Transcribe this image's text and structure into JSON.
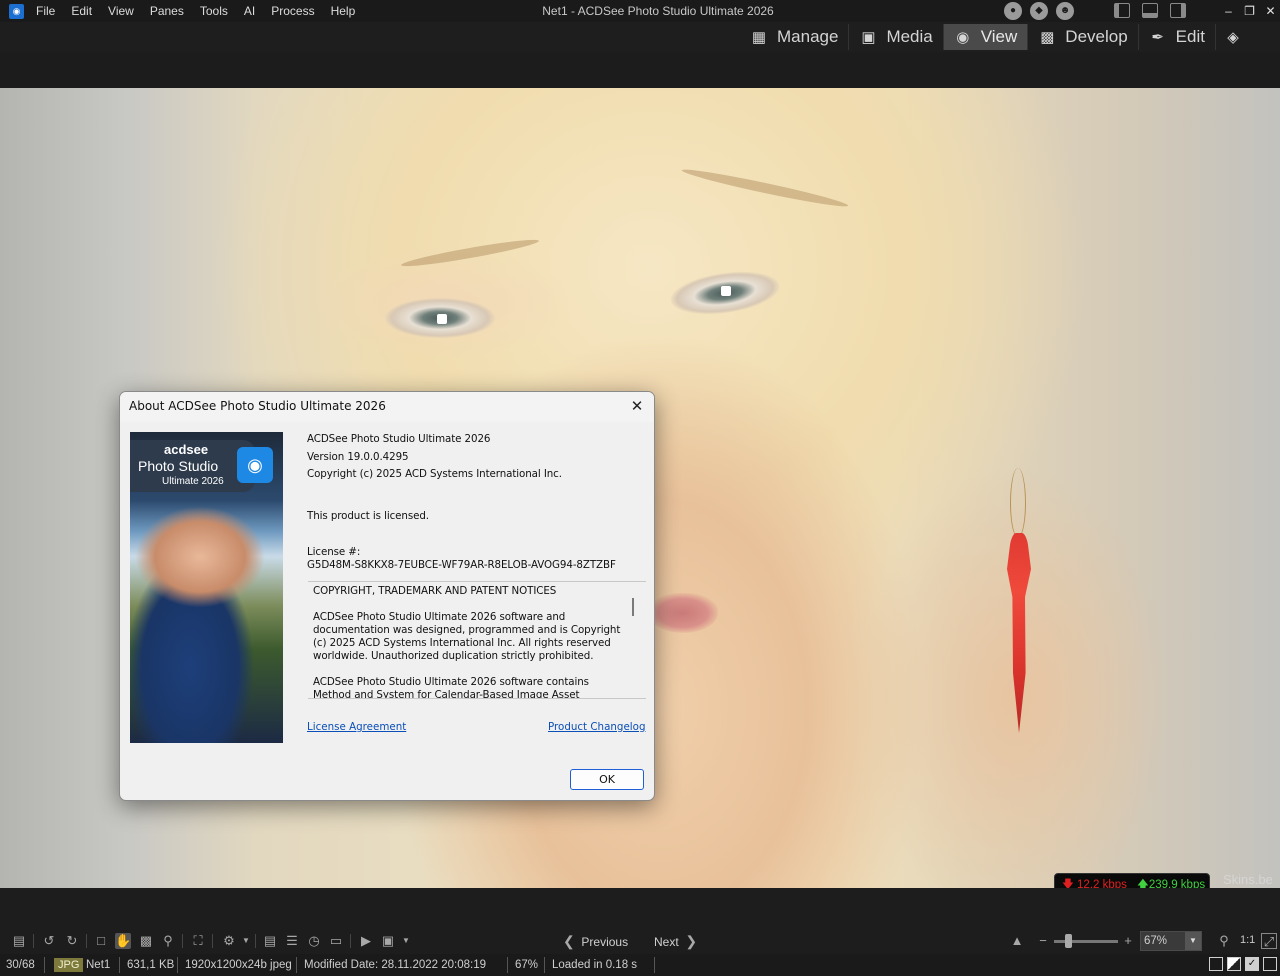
{
  "window": {
    "title": "Net1 - ACDSee Photo Studio Ultimate 2026",
    "menu": [
      "File",
      "Edit",
      "View",
      "Panes",
      "Tools",
      "AI",
      "Process",
      "Help"
    ]
  },
  "modes": [
    {
      "label": "Manage",
      "icon": "grid-icon",
      "active": false
    },
    {
      "label": "Media",
      "icon": "photos-icon",
      "active": false
    },
    {
      "label": "View",
      "icon": "eye-icon",
      "active": true
    },
    {
      "label": "Develop",
      "icon": "develop-icon",
      "active": false
    },
    {
      "label": "Edit",
      "icon": "brush-icon",
      "active": false
    }
  ],
  "dialog": {
    "title": "About ACDSee Photo Studio Ultimate 2026",
    "product_name": "ACDSee Photo Studio Ultimate 2026",
    "version": "Version 19.0.0.4295",
    "copyright": "Copyright (c) 2025 ACD Systems International Inc.",
    "licensed": "This product is licensed.",
    "license_label": "License #:",
    "license_key": "G5D48M-S8KKX8-7EUBCE-WF79AR-R8ELOB-AVOG94-8ZTZBF",
    "notice_text": "COPYRIGHT, TRADEMARK AND PATENT NOTICES\n\nACDSee Photo Studio Ultimate 2026 software and documentation was designed, programmed and is Copyright (c) 2025 ACD Systems International Inc. All rights reserved worldwide. Unauthorized duplication strictly prohibited.\n\nACDSee Photo Studio Ultimate 2026 software contains Method and System for Calendar-Based Image Asset Organization.",
    "link_license": "License Agreement",
    "link_changelog": "Product Changelog",
    "ok_label": "OK",
    "art": {
      "brand": "acdsee",
      "product": "Photo Studio",
      "edition": "Ultimate 2026"
    }
  },
  "network": {
    "down": "12,2 kbps",
    "up": "239,9 kbps",
    "watermark": "Skins.be"
  },
  "nav": {
    "previous": "Previous",
    "next": "Next",
    "zoom": "67%",
    "one_to_one": "1:1"
  },
  "status": {
    "position": "30/68",
    "format": "JPG",
    "filename": "Net1",
    "filesize": "631,1 KB",
    "dimensions": "1920x1200x24b jpeg",
    "modified": "Modified Date: 28.11.2022 20:08:19",
    "zoom": "67%",
    "load_time": "Loaded in 0.18 s"
  },
  "colors": {
    "accent": "#1f5ed6",
    "link": "#0b4fb8",
    "net_down": "#e02020",
    "net_up": "#40d040",
    "active_mode": "#4a4a4a"
  }
}
